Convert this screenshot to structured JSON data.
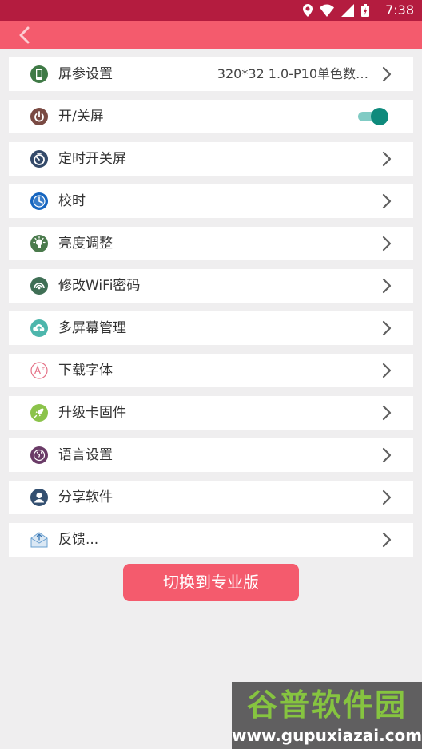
{
  "status_bar": {
    "time": "7:38"
  },
  "toolbar": {
    "back_icon": "chevron-left-icon"
  },
  "settings": [
    {
      "label": "屏参设置",
      "value": "320*32 1.0-P10单色数…",
      "icon": "phone-icon",
      "icon_color": "#3f7a46"
    },
    {
      "label": "开/关屏",
      "toggle": true,
      "icon": "power-icon",
      "icon_color": "#7a4a43"
    },
    {
      "label": "定时开关屏",
      "icon": "timer-icon",
      "icon_color": "#344a6a"
    },
    {
      "label": "校时",
      "icon": "clock-icon",
      "icon_color": "#1565c0"
    },
    {
      "label": "亮度调整",
      "icon": "bulb-icon",
      "icon_color": "#4a7a4c"
    },
    {
      "label": "修改WiFi密码",
      "icon": "wifi-icon",
      "icon_color": "#3f6f55"
    },
    {
      "label": "多屏幕管理",
      "icon": "cloud-upload-icon",
      "icon_color": "#4db6ac"
    },
    {
      "label": "下载字体",
      "icon": "font-icon",
      "icon_color": "#e57388"
    },
    {
      "label": "升级卡固件",
      "icon": "rocket-icon",
      "icon_color": "#8bc34a"
    },
    {
      "label": "语言设置",
      "icon": "globe-icon",
      "icon_color": "#6a3b67"
    },
    {
      "label": "分享软件",
      "icon": "user-icon",
      "icon_color": "#334f70"
    },
    {
      "label": "反馈...",
      "icon": "mail-icon",
      "icon_color": "#6aa0d0"
    }
  ],
  "pro_button": "切换到专业版",
  "watermark": {
    "title": "谷普软件园",
    "url": "www.gupuxiazai.com"
  },
  "colors": {
    "accent": "#f45b6d",
    "status_bar": "#b41c3f",
    "toggle_on": "#0e8a7c"
  }
}
